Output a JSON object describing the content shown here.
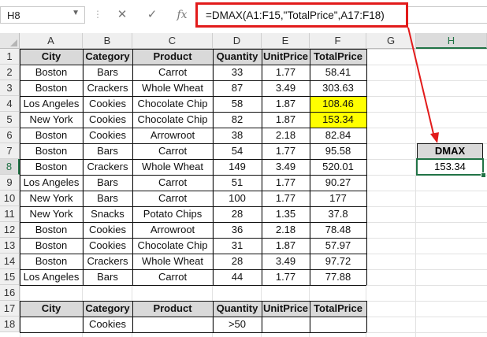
{
  "formula_bar": {
    "name_box": "H8",
    "dots": "⋮",
    "cancel": "✕",
    "enter": "✓",
    "fx": "fx",
    "formula": "=DMAX(A1:F15,\"TotalPrice\",A17:F18)"
  },
  "columns": [
    "A",
    "B",
    "C",
    "D",
    "E",
    "F",
    "G",
    "H"
  ],
  "rows": [
    "1",
    "2",
    "3",
    "4",
    "5",
    "6",
    "7",
    "8",
    "9",
    "10",
    "11",
    "12",
    "13",
    "14",
    "15",
    "16",
    "17",
    "18"
  ],
  "table": {
    "headers": [
      "City",
      "Category",
      "Product",
      "Quantity",
      "UnitPrice",
      "TotalPrice"
    ],
    "rows": [
      [
        "Boston",
        "Bars",
        "Carrot",
        "33",
        "1.77",
        "58.41"
      ],
      [
        "Boston",
        "Crackers",
        "Whole Wheat",
        "87",
        "3.49",
        "303.63"
      ],
      [
        "Los Angeles",
        "Cookies",
        "Chocolate Chip",
        "58",
        "1.87",
        "108.46"
      ],
      [
        "New York",
        "Cookies",
        "Chocolate Chip",
        "82",
        "1.87",
        "153.34"
      ],
      [
        "Boston",
        "Cookies",
        "Arrowroot",
        "38",
        "2.18",
        "82.84"
      ],
      [
        "Boston",
        "Bars",
        "Carrot",
        "54",
        "1.77",
        "95.58"
      ],
      [
        "Boston",
        "Crackers",
        "Whole Wheat",
        "149",
        "3.49",
        "520.01"
      ],
      [
        "Los Angeles",
        "Bars",
        "Carrot",
        "51",
        "1.77",
        "90.27"
      ],
      [
        "New York",
        "Bars",
        "Carrot",
        "100",
        "1.77",
        "177"
      ],
      [
        "New York",
        "Snacks",
        "Potato Chips",
        "28",
        "1.35",
        "37.8"
      ],
      [
        "Boston",
        "Cookies",
        "Arrowroot",
        "36",
        "2.18",
        "78.48"
      ],
      [
        "Boston",
        "Cookies",
        "Chocolate Chip",
        "31",
        "1.87",
        "57.97"
      ],
      [
        "Boston",
        "Crackers",
        "Whole Wheat",
        "28",
        "3.49",
        "97.72"
      ],
      [
        "Los Angeles",
        "Bars",
        "Carrot",
        "44",
        "1.77",
        "77.88"
      ]
    ]
  },
  "criteria": {
    "headers": [
      "City",
      "Category",
      "Product",
      "Quantity",
      "UnitPrice",
      "TotalPrice"
    ],
    "row": [
      "",
      "Cookies",
      "",
      ">50",
      "",
      ""
    ]
  },
  "result": {
    "label": "DMAX",
    "value": "153.34"
  },
  "colors": {
    "highlight": "#ffff00",
    "header_fill": "#d9d9d9",
    "annotation": "#e21b1b",
    "selection": "#217346"
  }
}
